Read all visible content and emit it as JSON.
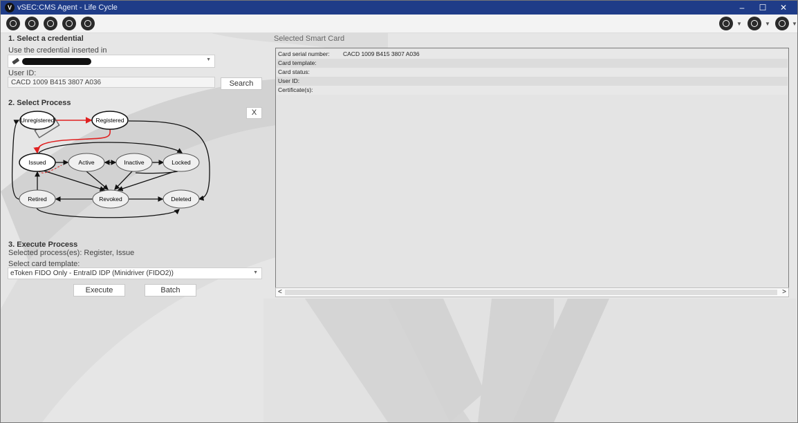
{
  "window": {
    "title": "vSEC:CMS Agent - Life Cycle",
    "logo_letter": "V",
    "min": "–",
    "max": "☐",
    "close": "✕"
  },
  "toolbar": {
    "left_icons": [
      "lifecycle-icon",
      "lock-icon",
      "shield-icon",
      "clipboard-icon",
      "refresh-icon"
    ],
    "right_icons": [
      "glasses-icon",
      "menu-icon",
      "user-icon"
    ]
  },
  "step1": {
    "heading": "1. Select a credential",
    "use_label": "Use the credential inserted in",
    "user_id_label": "User ID:",
    "user_id_value": "CACD 1009 B415 3807 A036",
    "search_label": "Search"
  },
  "step2": {
    "heading": "2. Select Process",
    "clear_label": "X",
    "states": {
      "unregistered": "Unregistered",
      "registered": "Registered",
      "issued": "Issued",
      "active": "Active",
      "inactive": "Inactive",
      "locked": "Locked",
      "retired": "Retired",
      "revoked": "Revoked",
      "deleted": "Deleted"
    }
  },
  "step3": {
    "heading": "3. Execute Process",
    "selected_processes": "Selected process(es): Register, Issue",
    "template_label": "Select card template:",
    "template_value": "eToken FIDO Only - EntraID IDP (Minidriver (FIDO2))",
    "execute_label": "Execute",
    "batch_label": "Batch"
  },
  "smart_card": {
    "heading": "Selected Smart Card",
    "rows": [
      {
        "label": "Card serial number:",
        "value": "CACD 1009 B415 3807 A036"
      },
      {
        "label": "Card template:",
        "value": ""
      },
      {
        "label": "Card status:",
        "value": ""
      },
      {
        "label": "User ID:",
        "value": ""
      },
      {
        "label": "Certificate(s):",
        "value": ""
      }
    ],
    "scroll_left": "<",
    "scroll_right": ">"
  },
  "colors": {
    "titlebar": "#1f3c88",
    "selected_path": "#e02020"
  }
}
